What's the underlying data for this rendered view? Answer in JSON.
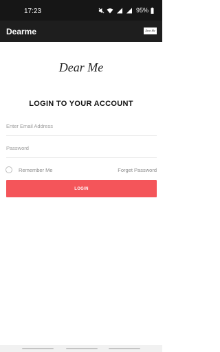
{
  "status_bar": {
    "time": "17:23",
    "battery_percent": "95%"
  },
  "app_bar": {
    "title": "Dearme",
    "logo_text": "Dear Me"
  },
  "brand": {
    "logo_text": "Dear Me"
  },
  "login": {
    "heading": "LOGIN TO YOUR ACCOUNT",
    "email_placeholder": "Enter Email Address",
    "password_placeholder": "Password",
    "remember_label": "Remember Me",
    "forget_label": "Forget Password",
    "button_label": "LOGIN"
  },
  "colors": {
    "status_bar_bg": "#161616",
    "app_bar_bg": "#1e1e1e",
    "accent": "#f4555a"
  }
}
